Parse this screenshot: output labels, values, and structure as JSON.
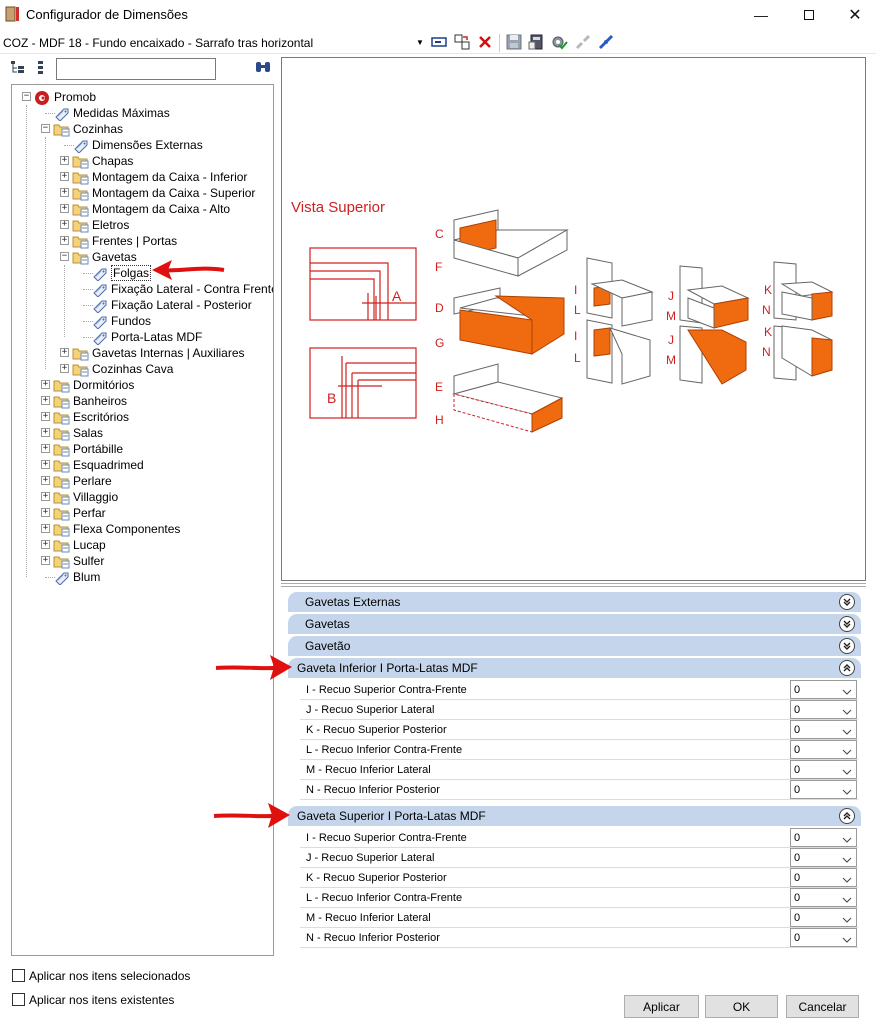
{
  "window": {
    "title": "Configurador de Dimensões"
  },
  "toolbar": {
    "config_value": "COZ - MDF 18 - Fundo encaixado - Sarrafo tras horizontal"
  },
  "tree": {
    "search_placeholder": "",
    "nodes": [
      {
        "label": "Promob",
        "icon": "promob-logo-icon",
        "level": 0,
        "toggle": "-"
      },
      {
        "label": "Medidas Máximas",
        "icon": "tag-icon",
        "level": 1
      },
      {
        "label": "Cozinhas",
        "icon": "folder-icon",
        "level": 1,
        "toggle": "-"
      },
      {
        "label": "Dimensões Externas",
        "icon": "tag-icon",
        "level": 2
      },
      {
        "label": "Chapas",
        "icon": "folder-icon",
        "level": 2,
        "toggle": "+"
      },
      {
        "label": "Montagem da Caixa - Inferior",
        "icon": "folder-icon",
        "level": 2,
        "toggle": "+"
      },
      {
        "label": "Montagem da Caixa - Superior",
        "icon": "folder-icon",
        "level": 2,
        "toggle": "+"
      },
      {
        "label": "Montagem da Caixa - Alto",
        "icon": "folder-icon",
        "level": 2,
        "toggle": "+"
      },
      {
        "label": "Eletros",
        "icon": "folder-icon",
        "level": 2,
        "toggle": "+"
      },
      {
        "label": "Frentes | Portas",
        "icon": "folder-icon",
        "level": 2,
        "toggle": "+"
      },
      {
        "label": "Gavetas",
        "icon": "folder-icon",
        "level": 2,
        "toggle": "-"
      },
      {
        "label": "Folgas",
        "icon": "tag-icon",
        "level": 3,
        "selected": true
      },
      {
        "label": "Fixação Lateral - Contra Frente",
        "icon": "tag-icon",
        "level": 3
      },
      {
        "label": "Fixação Lateral - Posterior",
        "icon": "tag-icon",
        "level": 3
      },
      {
        "label": "Fundos",
        "icon": "tag-icon",
        "level": 3
      },
      {
        "label": "Porta-Latas MDF",
        "icon": "tag-icon",
        "level": 3
      },
      {
        "label": "Gavetas Internas | Auxiliares",
        "icon": "folder-icon",
        "level": 2,
        "toggle": "+"
      },
      {
        "label": "Cozinhas Cava",
        "icon": "folder-icon",
        "level": 2,
        "toggle": "+"
      },
      {
        "label": "Dormitórios",
        "icon": "folder-icon",
        "level": 1,
        "toggle": "+"
      },
      {
        "label": "Banheiros",
        "icon": "folder-icon",
        "level": 1,
        "toggle": "+"
      },
      {
        "label": "Escritórios",
        "icon": "folder-icon",
        "level": 1,
        "toggle": "+"
      },
      {
        "label": "Salas",
        "icon": "folder-icon",
        "level": 1,
        "toggle": "+"
      },
      {
        "label": "Portábille",
        "icon": "folder-icon",
        "level": 1,
        "toggle": "+"
      },
      {
        "label": "Esquadrimed",
        "icon": "folder-icon",
        "level": 1,
        "toggle": "+"
      },
      {
        "label": "Perlare",
        "icon": "folder-icon",
        "level": 1,
        "toggle": "+"
      },
      {
        "label": "Villaggio",
        "icon": "folder-icon",
        "level": 1,
        "toggle": "+"
      },
      {
        "label": "Perfar",
        "icon": "folder-icon",
        "level": 1,
        "toggle": "+"
      },
      {
        "label": "Flexa Componentes",
        "icon": "folder-icon",
        "level": 1,
        "toggle": "+"
      },
      {
        "label": "Lucap",
        "icon": "folder-icon",
        "level": 1,
        "toggle": "+"
      },
      {
        "label": "Sulfer",
        "icon": "folder-icon",
        "level": 1,
        "toggle": "+"
      },
      {
        "label": "Blum",
        "icon": "tag-icon",
        "level": 1
      }
    ]
  },
  "options": {
    "apply_selected": "Aplicar nos itens selecionados",
    "apply_existing": "Aplicar nos itens existentes"
  },
  "preview": {
    "title": "Vista Superior",
    "letters": [
      "A",
      "B",
      "C",
      "D",
      "E",
      "F",
      "G",
      "H",
      "I",
      "J",
      "K",
      "L",
      "M",
      "N"
    ]
  },
  "sections": [
    {
      "label": "Gavetas Externas",
      "expanded": false
    },
    {
      "label": "Gavetas",
      "expanded": false
    },
    {
      "label": "Gavetão",
      "expanded": false
    },
    {
      "label": "Gaveta Inferior I Porta-Latas MDF",
      "expanded": true,
      "rows": [
        {
          "label": "I - Recuo Superior Contra-Frente",
          "value": "0"
        },
        {
          "label": "J - Recuo Superior Lateral",
          "value": "0"
        },
        {
          "label": "K - Recuo Superior Posterior",
          "value": "0"
        },
        {
          "label": "L - Recuo Inferior Contra-Frente",
          "value": "0"
        },
        {
          "label": "M - Recuo Inferior Lateral",
          "value": "0"
        },
        {
          "label": "N - Recuo Inferior Posterior",
          "value": "0"
        }
      ]
    },
    {
      "label": "Gaveta Superior I Porta-Latas MDF",
      "expanded": true,
      "rows": [
        {
          "label": "I - Recuo Superior Contra-Frente",
          "value": "0"
        },
        {
          "label": "J - Recuo Superior Lateral",
          "value": "0"
        },
        {
          "label": "K - Recuo Superior Posterior",
          "value": "0"
        },
        {
          "label": "L - Recuo Inferior Contra-Frente",
          "value": "0"
        },
        {
          "label": "M - Recuo Inferior Lateral",
          "value": "0"
        },
        {
          "label": "N - Recuo Inferior Posterior",
          "value": "0"
        }
      ]
    }
  ],
  "buttons": {
    "apply": "Aplicar",
    "ok": "OK",
    "cancel": "Cancelar"
  },
  "colors": {
    "accent_orange": "#f06a10",
    "diagram_red": "#d02020",
    "section_blue": "#c5d6ec",
    "annotation_red": "#e01010"
  }
}
